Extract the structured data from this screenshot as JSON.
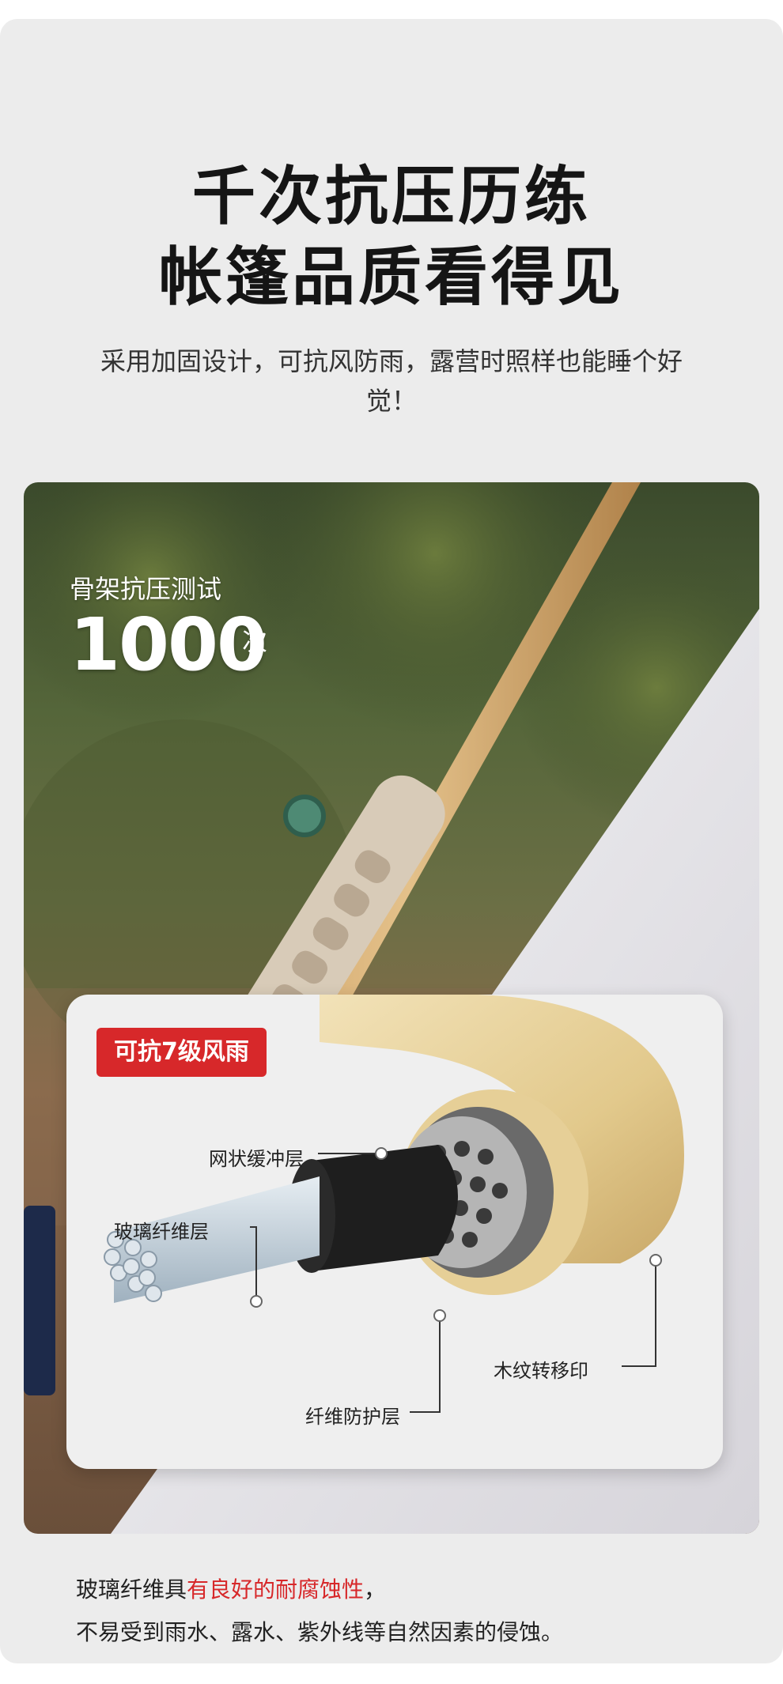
{
  "headline": {
    "line1": "千次抗压历练",
    "line2": "帐篷品质看得见"
  },
  "subtitle": "采用加固设计，可抗风防雨，露营时照样也能睡个好觉！",
  "stat": {
    "label": "骨架抗压测试",
    "value": "1000",
    "unit": "次"
  },
  "inset": {
    "badge": "可抗7级风雨",
    "callouts": {
      "mesh_layer": "网状缓冲层",
      "fiberglass_layer": "玻璃纤维层",
      "wood_grain": "木纹转移印",
      "fiber_protect": "纤维防护层"
    }
  },
  "footer": {
    "prefix": "玻璃纤维具",
    "highlight": "有良好的耐腐蚀性",
    "suffix": "，",
    "line2": "不易受到雨水、露水、紫外线等自然因素的侵蚀。"
  },
  "colors": {
    "accent": "#d7282a",
    "card_bg": "#ececec",
    "inset_bg": "#efefef"
  }
}
